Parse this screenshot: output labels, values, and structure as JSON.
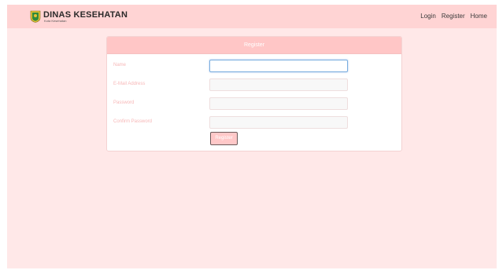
{
  "brand": {
    "title": "DINAS KESEHATAN",
    "subtitle": "Kota Kesehatan"
  },
  "nav": {
    "login": "Login",
    "register": "Register",
    "home": "Home"
  },
  "form": {
    "header": "Register",
    "fields": [
      {
        "label": "Name",
        "value": "",
        "focused": true
      },
      {
        "label": "E-Mail Address",
        "value": ""
      },
      {
        "label": "Password",
        "value": ""
      },
      {
        "label": "Confirm Password",
        "value": ""
      }
    ],
    "submit_label": "Register"
  },
  "colors": {
    "navbar": "#ffd4d4",
    "page_background": "#ffe8e8",
    "card_header": "#ffc6c6",
    "label_text": "#f7b7b7",
    "button": "#ffc8c8"
  },
  "icons": {
    "logo": "emblem-logo-icon"
  }
}
